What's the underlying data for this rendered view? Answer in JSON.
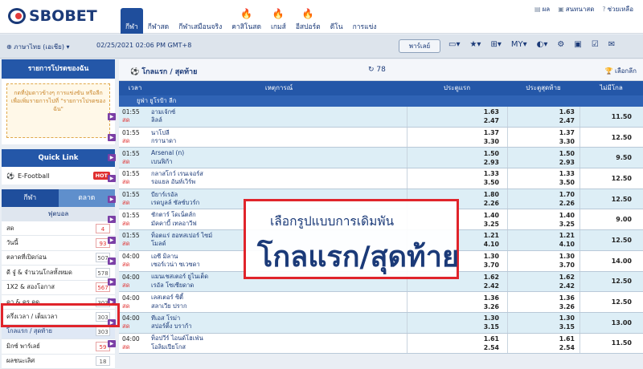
{
  "brand": "SBOBET",
  "nav": [
    {
      "label": "กีฬา",
      "active": true,
      "flame": false
    },
    {
      "label": "กีฬาสด",
      "active": false,
      "flame": false
    },
    {
      "label": "กีฬาเสมือนจริง",
      "active": false,
      "flame": false
    },
    {
      "label": "คาสิโนสด",
      "active": false,
      "flame": true
    },
    {
      "label": "เกมส์",
      "active": false,
      "flame": true
    },
    {
      "label": "อีสปอร์ต",
      "active": false,
      "flame": true
    },
    {
      "label": "ดีโน",
      "active": false,
      "flame": false
    },
    {
      "label": "การแข่ง",
      "active": false,
      "flame": false
    }
  ],
  "toplinks": {
    "balance": "ผล",
    "messages": "สนทนาสด",
    "help": "ช่วยเหลือ"
  },
  "subbar": {
    "language": "ภาษาไทย (เอเชีย)",
    "datetime": "02/25/2021 02:06 PM GMT+8",
    "parlay": "พาร์เลย์",
    "odds_type": "MY"
  },
  "sidebar": {
    "my_list_title": "รายการโปรดของฉัน",
    "my_list_notice": "กดที่ปุ่มดาวข้างๆ การแข่งขัน หรือลีกเพื่อเพิ่มรายการไปที่ \"รายการโปรดของฉัน\"",
    "quick_link_title": "Quick Link",
    "quick_link_item": "E-Football",
    "quick_link_badge": "HOT",
    "tab_sports": "กีฬา",
    "tab_market": "ตลาด",
    "category": "ฟุตบอล",
    "menu": [
      {
        "label": "สด",
        "count": "4",
        "red": true
      },
      {
        "label": "วันนี้",
        "count": "93",
        "red": true
      },
      {
        "label": "ตลาดที่เปิดก่อน",
        "count": "507",
        "red": false
      },
      {
        "label": "ดี จู๋ & จำนวนโกลทั้งหมด",
        "count": "578",
        "red": false
      },
      {
        "label": "1X2 & สองโอกาส",
        "count": "567",
        "red": true
      },
      {
        "label": "คา & คร คด",
        "count": "303",
        "red": false
      },
      {
        "label": "ครึ่งเวลา / เต็มเวลา",
        "count": "303",
        "red": false
      },
      {
        "label": "โกลแรก / สุดท้าย",
        "count": "303",
        "red": false,
        "selected": true
      },
      {
        "label": "มิกซ์ พาร์เลย์",
        "count": "59",
        "red": true
      },
      {
        "label": "ผลชนะเลิศ",
        "count": "18",
        "red": false
      }
    ]
  },
  "main": {
    "title": "โกลแรก / สุดท้าย",
    "refresh_count": "78",
    "select_league": "เลือกลีก",
    "headers": {
      "time": "เวลา",
      "event": "เหตุการณ์",
      "first": "ประตูแรก",
      "last": "ประตูสุดท้าย",
      "nogoal": "ไม่มีโกล"
    },
    "league": "ยูฟ่า ยูโรป้า ลีก",
    "rows": [
      {
        "time": "01:55",
        "live": "สด",
        "home": "อามเจ้กซ์",
        "away": "ลิลล์",
        "first": [
          "1.63",
          "2.47"
        ],
        "last": [
          "1.63",
          "2.47"
        ],
        "nogoal": "11.50"
      },
      {
        "time": "01:55",
        "live": "สด",
        "home": "นาโปลี",
        "away": "กรานาดา",
        "first": [
          "1.37",
          "3.30"
        ],
        "last": [
          "1.37",
          "3.30"
        ],
        "nogoal": "12.50"
      },
      {
        "time": "01:55",
        "live": "สด",
        "home": "Arsenal (n)",
        "away": "เบนฟิก้า",
        "first": [
          "1.50",
          "2.93"
        ],
        "last": [
          "1.50",
          "2.93"
        ],
        "nogoal": "9.50"
      },
      {
        "time": "01:55",
        "live": "สด",
        "home": "กลาสโกว์ เรนเจอร์ส",
        "away": "รอแยล อันท์เวิร์พ",
        "first": [
          "1.33",
          "3.50"
        ],
        "last": [
          "1.33",
          "3.50"
        ],
        "nogoal": "12.50"
      },
      {
        "time": "01:55",
        "live": "สด",
        "home": "บียาร์เรอัล",
        "away": "เรดบูลล์ ซัลซ์บวร์ก",
        "first": [
          "1.80",
          "2.26"
        ],
        "last": [
          "1.70",
          "2.26"
        ],
        "nogoal": "12.50"
      },
      {
        "time": "01:55",
        "live": "สด",
        "home": "ชักตาร์ โดเน็ตส์ก",
        "away": "มัคคาบี้ เทลอาวีฟ",
        "first": [
          "1.40",
          "3.25"
        ],
        "last": [
          "1.40",
          "3.25"
        ],
        "nogoal": "9.00"
      },
      {
        "time": "01:55",
        "live": "สด",
        "home": "ท็อตแร่ ฮอทสเปอร์ ไซม์",
        "away": "โมลด์",
        "first": [
          "1.21",
          "4.10"
        ],
        "last": [
          "1.21",
          "4.10"
        ],
        "nogoal": "12.50"
      },
      {
        "time": "04:00",
        "live": "สด",
        "home": "เอซี มิลาน",
        "away": "เซอร์เวน่า ซเวซดา",
        "first": [
          "1.30",
          "3.70"
        ],
        "last": [
          "1.30",
          "3.70"
        ],
        "nogoal": "14.00"
      },
      {
        "time": "04:00",
        "live": "สด",
        "home": "แมนเชสเตอร์ ยูไนเต็ด",
        "away": "เรอัล โซเซียดาด",
        "first": [
          "1.62",
          "2.42"
        ],
        "last": [
          "1.62",
          "2.42"
        ],
        "nogoal": "12.50"
      },
      {
        "time": "04:00",
        "live": "สด",
        "home": "เลสเตอร์ ซิตี้",
        "away": "สลาเวีย ปราก",
        "first": [
          "1.36",
          "3.26"
        ],
        "last": [
          "1.36",
          "3.26"
        ],
        "nogoal": "12.50"
      },
      {
        "time": "04:00",
        "live": "สด",
        "home": "ทีเอส โรม่า",
        "away": "สปอร์ติ้ง บราก้า",
        "first": [
          "1.30",
          "3.15"
        ],
        "last": [
          "1.30",
          "3.15"
        ],
        "nogoal": "13.00"
      },
      {
        "time": "04:00",
        "live": "สด",
        "home": "ท็อปวีร์ ไอนด์โฮเฟ่น",
        "away": "โอลิมเปียโกส",
        "first": [
          "1.61",
          "2.54"
        ],
        "last": [
          "1.61",
          "2.54"
        ],
        "nogoal": "11.50"
      }
    ]
  },
  "overlay": {
    "line1": "เลือกรูปแบบการเดิมพัน",
    "line2": "โกลแรก/สุดท้าย"
  },
  "colors": {
    "primary": "#2457a8",
    "highlight": "#e0242b",
    "row_tint": "#ddeef6"
  }
}
